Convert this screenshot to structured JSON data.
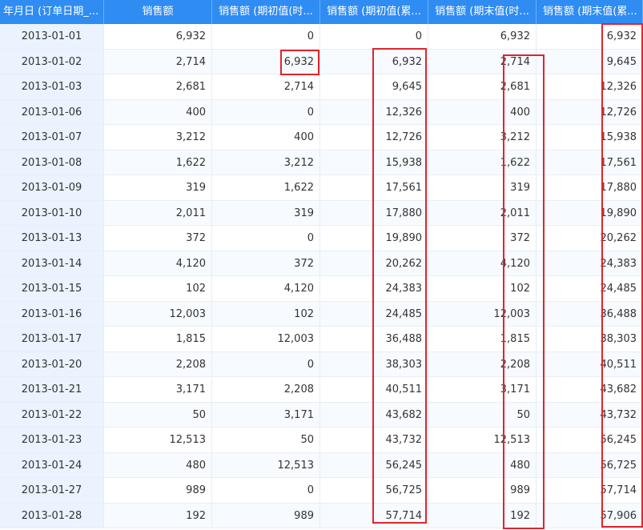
{
  "table": {
    "headers": [
      "年月日 (订单日期_...",
      "销售额",
      "销售额 (期初值(时...",
      "销售额 (期初值(累...",
      "销售额 (期末值(时...",
      "销售额 (期末值(累..."
    ],
    "rows": [
      [
        "2013-01-01",
        "6,932",
        "0",
        "0",
        "6,932",
        "6,932"
      ],
      [
        "2013-01-02",
        "2,714",
        "6,932",
        "6,932",
        "2,714",
        "9,645"
      ],
      [
        "2013-01-03",
        "2,681",
        "2,714",
        "9,645",
        "2,681",
        "12,326"
      ],
      [
        "2013-01-06",
        "400",
        "0",
        "12,326",
        "400",
        "12,726"
      ],
      [
        "2013-01-07",
        "3,212",
        "400",
        "12,726",
        "3,212",
        "15,938"
      ],
      [
        "2013-01-08",
        "1,622",
        "3,212",
        "15,938",
        "1,622",
        "17,561"
      ],
      [
        "2013-01-09",
        "319",
        "1,622",
        "17,561",
        "319",
        "17,880"
      ],
      [
        "2013-01-10",
        "2,011",
        "319",
        "17,880",
        "2,011",
        "19,890"
      ],
      [
        "2013-01-13",
        "372",
        "0",
        "19,890",
        "372",
        "20,262"
      ],
      [
        "2013-01-14",
        "4,120",
        "372",
        "20,262",
        "4,120",
        "24,383"
      ],
      [
        "2013-01-15",
        "102",
        "4,120",
        "24,383",
        "102",
        "24,485"
      ],
      [
        "2013-01-16",
        "12,003",
        "102",
        "24,485",
        "12,003",
        "36,488"
      ],
      [
        "2013-01-17",
        "1,815",
        "12,003",
        "36,488",
        "1,815",
        "38,303"
      ],
      [
        "2013-01-20",
        "2,208",
        "0",
        "38,303",
        "2,208",
        "40,511"
      ],
      [
        "2013-01-21",
        "3,171",
        "2,208",
        "40,511",
        "3,171",
        "43,682"
      ],
      [
        "2013-01-22",
        "50",
        "3,171",
        "43,682",
        "50",
        "43,732"
      ],
      [
        "2013-01-23",
        "12,513",
        "50",
        "43,732",
        "12,513",
        "56,245"
      ],
      [
        "2013-01-24",
        "480",
        "12,513",
        "56,245",
        "480",
        "56,725"
      ],
      [
        "2013-01-27",
        "989",
        "0",
        "56,725",
        "989",
        "57,714"
      ],
      [
        "2013-01-28",
        "192",
        "989",
        "57,714",
        "192",
        "57,906"
      ]
    ]
  },
  "colors": {
    "header_bg": "#2f8cf2",
    "date_column_bg": "#eaf3fe",
    "highlight_border": "#e0242d"
  }
}
